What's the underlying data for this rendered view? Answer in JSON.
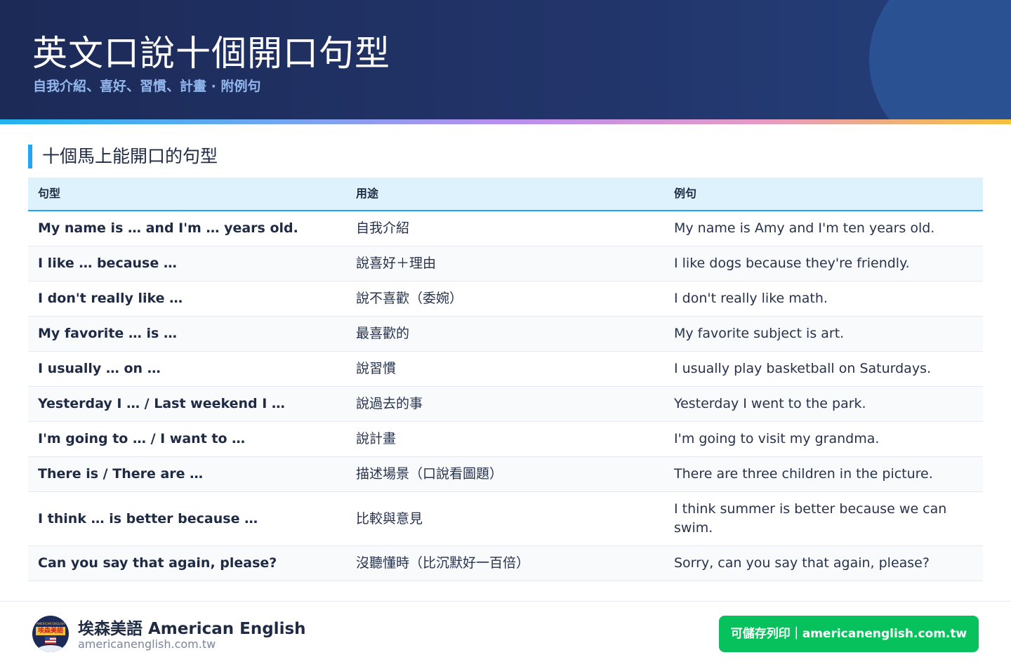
{
  "header": {
    "title": "英文口說十個開口句型",
    "subtitle": "自我介紹、喜好、習慣、計畫 · 附例句"
  },
  "section": {
    "title": "十個馬上能開口的句型"
  },
  "table": {
    "headers": [
      "句型",
      "用途",
      "例句"
    ],
    "rows": [
      {
        "pattern": "My name is … and I'm … years old.",
        "usage": "自我介紹",
        "example": "My name is Amy and I'm ten years old."
      },
      {
        "pattern": "I like … because …",
        "usage": "說喜好＋理由",
        "example": "I like dogs because they're friendly."
      },
      {
        "pattern": "I don't really like …",
        "usage": "說不喜歡（委婉）",
        "example": "I don't really like math."
      },
      {
        "pattern": "My favorite … is …",
        "usage": "最喜歡的",
        "example": "My favorite subject is art."
      },
      {
        "pattern": "I usually … on …",
        "usage": "說習慣",
        "example": "I usually play basketball on Saturdays."
      },
      {
        "pattern": "Yesterday I … / Last weekend I …",
        "usage": "說過去的事",
        "example": "Yesterday I went to the park."
      },
      {
        "pattern": "I'm going to … / I want to …",
        "usage": "說計畫",
        "example": "I'm going to visit my grandma."
      },
      {
        "pattern": "There is / There are …",
        "usage": "描述場景（口說看圖題）",
        "example": "There are three children in the picture."
      },
      {
        "pattern": "I think … is better because …",
        "usage": "比較與意見",
        "example": "I think summer is better because we can swim."
      },
      {
        "pattern": "Can you say that again, please?",
        "usage": "沒聽懂時（比沉默好一百倍）",
        "example": "Sorry, can you say that again, please?"
      }
    ]
  },
  "footer": {
    "logo_top_text": "AMERICAN ENGLISH",
    "logo_text": "埃森美語",
    "brand_name": "埃森美語 American English",
    "brand_url": "americanenglish.com.tw",
    "cta_label": "可儲存列印｜americanenglish.com.tw"
  },
  "colors": {
    "header_bg": "#1c2a57",
    "accent": "#1ea7f5",
    "cta_green": "#07c25c",
    "subtitle": "#93b8ee"
  }
}
